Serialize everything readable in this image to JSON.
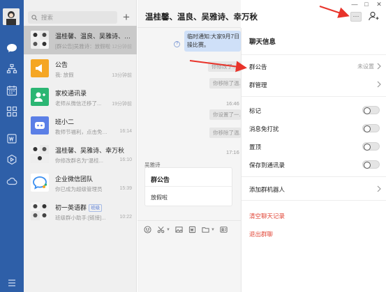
{
  "search": {
    "placeholder": "搜索"
  },
  "conversations": [
    {
      "name": "温桂馨、温良、吴雅诗、幸万秋",
      "preview": "[群公告]吴雅诗：放假啦",
      "time": "12分钟前"
    },
    {
      "name": "公告",
      "preview": "我: 放假",
      "time": "13分钟前"
    },
    {
      "name": "家校通讯录",
      "preview": "老师从微信迁移了...",
      "time": "19分钟前"
    },
    {
      "name": "班小二",
      "preview": "教师节福利，点击免费...",
      "time": "16:14"
    },
    {
      "name": "温桂馨、吴雅诗、幸万秋",
      "preview": "你修改群名为\"温桂...",
      "time": "16:10"
    },
    {
      "name": "企业微信团队",
      "preview": "你已成为超级管理员",
      "time": "15:39"
    },
    {
      "name": "初一英语群",
      "tag": "班级",
      "preview": "班级群小助手:[链接]...",
      "time": "10:22"
    }
  ],
  "chat": {
    "title": "温桂馨、温良、吴雅诗、幸万秋",
    "notice_line1": "临时通知:大家9月7日",
    "notice_line2": "操比赛。",
    "sys1": "你修改了...",
    "sys2": "你移除了温...",
    "time1": "16:46",
    "sys3": "你设置了一...",
    "sys4": "你移除了温...",
    "time2": "17:16",
    "sender": "吴雅诗",
    "card_title": "群公告",
    "card_body": "放假啦"
  },
  "panel": {
    "title": "聊天信息",
    "announcement_label": "群公告",
    "announcement_value": "未设置",
    "manage_label": "群管理",
    "mark_label": "标记",
    "dnd_label": "消息免打扰",
    "pin_label": "置顶",
    "save_label": "保存到通讯录",
    "bot_label": "添加群机器人",
    "clear_label": "清空聊天记录",
    "exit_label": "退出群聊"
  },
  "colors": {
    "sidebar": "#2e5fa8",
    "accent_red": "#e24a3b",
    "arrow_red": "#e8332a"
  }
}
